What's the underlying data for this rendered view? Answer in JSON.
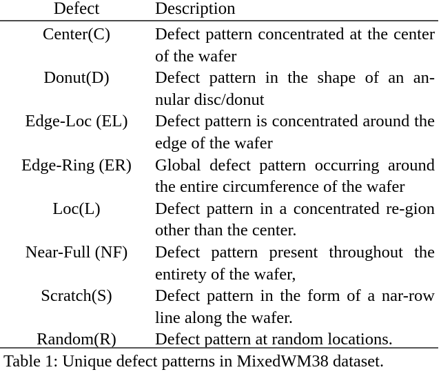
{
  "table": {
    "headers": {
      "defect": "Defect",
      "description": "Description"
    },
    "rows": [
      {
        "defect": "Center(C)",
        "lines": [
          "Defect pattern concentrated at the",
          "center of the wafer"
        ],
        "description": "Defect pattern concentrated at the center of the wafer"
      },
      {
        "defect": "Donut(D)",
        "lines": [
          "Defect pattern in the shape of an an-",
          "nular disc/donut"
        ],
        "description": "Defect pattern in the shape of an annular disc/donut"
      },
      {
        "defect": "Edge-Loc (EL)",
        "lines": [
          "Defect pattern is concentrated",
          "around the edge of the wafer"
        ],
        "description": "Defect pattern is concentrated around the edge of the wafer"
      },
      {
        "defect": "Edge-Ring (ER)",
        "lines": [
          "Global defect pattern occurring",
          "around the entire circumference of",
          "the wafer"
        ],
        "description": "Global defect pattern occurring around the entire circumference of the wafer"
      },
      {
        "defect": "Loc(L)",
        "lines": [
          "Defect pattern in a concentrated re-",
          "gion other than the center."
        ],
        "description": "Defect pattern in a concentrated region other than the center."
      },
      {
        "defect": "Near-Full (NF)",
        "lines": [
          "Defect pattern present throughout",
          "the entirety of the wafer,"
        ],
        "description": "Defect pattern present throughout the entirety of the wafer,"
      },
      {
        "defect": "Scratch(S)",
        "lines": [
          "Defect pattern in the form of a nar-",
          "row line along the wafer."
        ],
        "description": "Defect pattern in the form of a narrow line along the wafer."
      },
      {
        "defect": "Random(R)",
        "lines": [
          "Defect pattern at random locations."
        ],
        "description": "Defect pattern at random locations."
      }
    ]
  },
  "caption": {
    "text": "Table 1: Unique defect patterns in MixedWM38 dataset."
  },
  "colors": {
    "text": "#000000",
    "rule": "#4a4a4a",
    "background": "#ffffff"
  }
}
